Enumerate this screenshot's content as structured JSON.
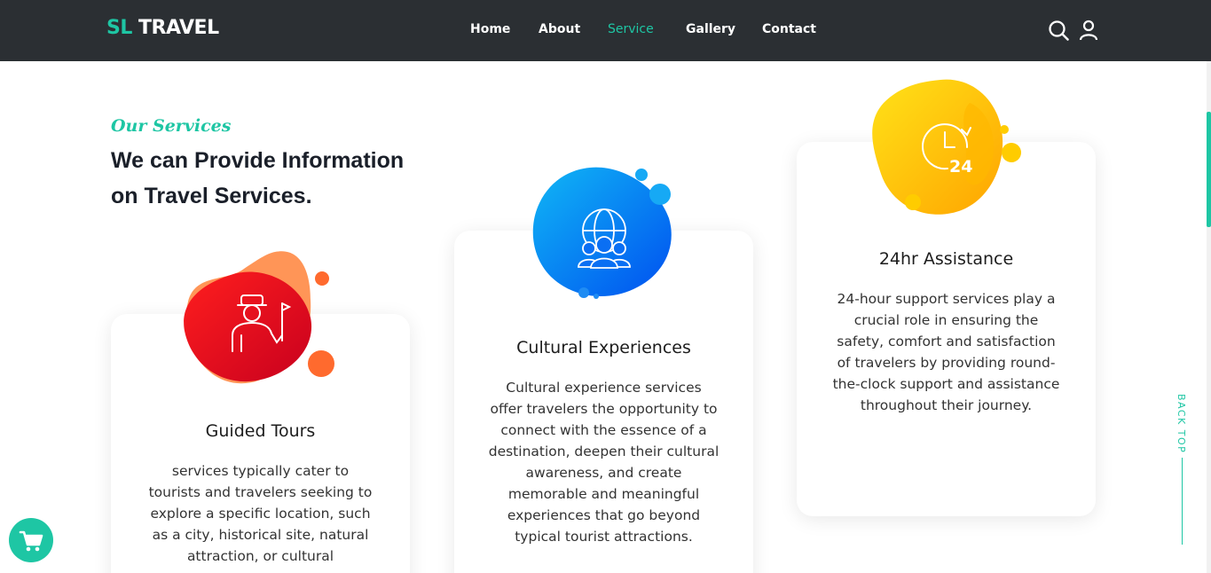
{
  "brand": {
    "prefix": "SL",
    "name": "TRAVEL"
  },
  "nav": {
    "items": [
      {
        "label": "Home",
        "active": false
      },
      {
        "label": "About",
        "active": false
      },
      {
        "label": "Service",
        "active": true
      },
      {
        "label": "Gallery",
        "active": false
      },
      {
        "label": "Contact",
        "active": false
      }
    ]
  },
  "header_icons": [
    "search-icon",
    "user-icon"
  ],
  "section": {
    "eyebrow": "Our Services",
    "title": "We can Provide Information on Travel Services."
  },
  "cards": [
    {
      "title": "Guided Tours",
      "text": "services typically cater to tourists and travelers seeking to explore a specific location, such as a city, historical site, natural attraction, or cultural",
      "icon": "tour-guide-icon",
      "blob_color": "#ee1c25"
    },
    {
      "title": "Cultural Experiences",
      "text": "Cultural experience services offer travelers the opportunity to connect with the essence of a destination, deepen their cultural awareness, and create memorable and meaningful experiences that go beyond typical tourist attractions.",
      "icon": "globe-people-icon",
      "blob_color": "#0a8cf5"
    },
    {
      "title": "24hr Assistance",
      "text": "24-hour support services play a crucial role in ensuring the safety, comfort and satisfaction of travelers by providing round-the-clock support and assistance throughout their journey.",
      "icon": "clock-24-icon",
      "blob_color": "#ffbf00"
    }
  ],
  "back_top": "BACK TOP",
  "cart_icon": "cart-icon",
  "colors": {
    "accent": "#1ec6a4",
    "header_bg": "#2b2f33"
  }
}
